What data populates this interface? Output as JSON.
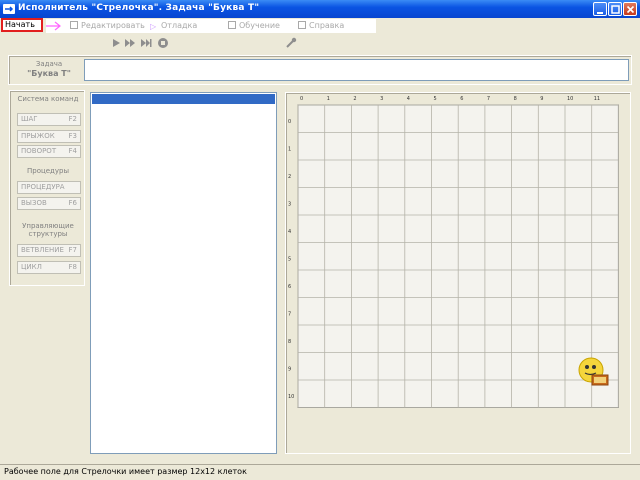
{
  "window": {
    "title": "Исполнитель \"Стрелочка\". Задача \"Буква Т\""
  },
  "menu": {
    "start": "Начать",
    "items": [
      "Редактировать",
      "Отладка",
      "Обучение",
      "Справка"
    ]
  },
  "task": {
    "label": "Задача",
    "name": "\"Буква Т\""
  },
  "commands": {
    "system_title": "Система команд",
    "system": [
      {
        "label": "ШАГ",
        "key": "F2"
      },
      {
        "label": "ПРЫЖОК",
        "key": "F3"
      },
      {
        "label": "ПОВОРОТ",
        "key": "F4"
      }
    ],
    "procedures_title": "Процедуры",
    "procedures": [
      {
        "label": "ПРОЦЕДУРА",
        "key": ""
      },
      {
        "label": "ВЫЗОВ",
        "key": "F6"
      }
    ],
    "control_title": "Управляющие структуры",
    "control": [
      {
        "label": "ВЕТВЛЕНИЕ",
        "key": "F7"
      },
      {
        "label": "ЦИКЛ",
        "key": "F8"
      }
    ]
  },
  "field": {
    "cols": 12,
    "rows": 11,
    "x_labels": [
      "0",
      "1",
      "2",
      "3",
      "4",
      "5",
      "6",
      "7",
      "8",
      "9",
      "10",
      "11"
    ],
    "y_labels": [
      "0",
      "1",
      "2",
      "3",
      "4",
      "5",
      "6",
      "7",
      "8",
      "9",
      "10"
    ],
    "robot_col": 11,
    "robot_row": 9
  },
  "status": {
    "text": "Рабочее поле для Стрелочки имеет размер 12x12 клеток"
  },
  "colors": {
    "titlebar": "#0a54e3",
    "accent": "#e21e1e",
    "selection": "#316ac5"
  }
}
